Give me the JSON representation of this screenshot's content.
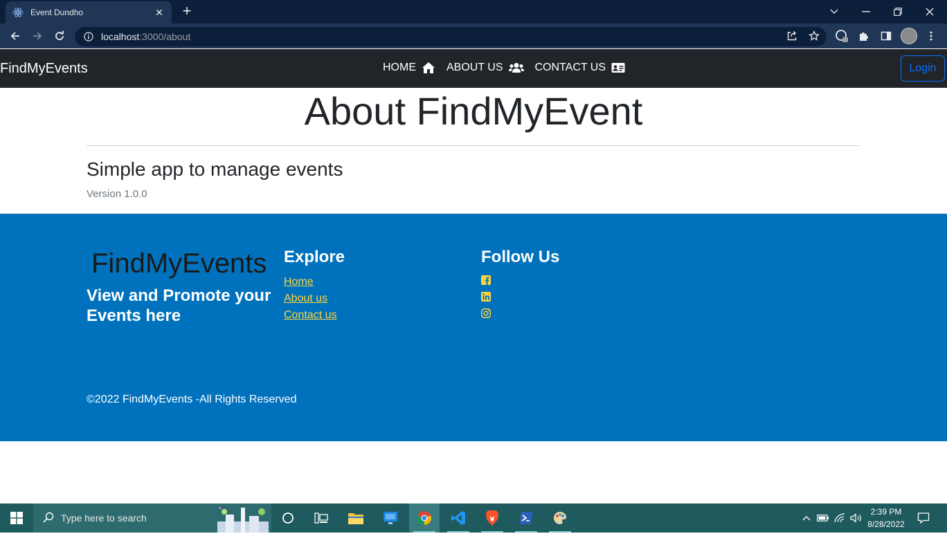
{
  "browser": {
    "tab_title": "Event Dundho",
    "url_host": "localhost",
    "url_path": ":3000/about"
  },
  "navbar": {
    "brand": "FindMyEvents",
    "links": [
      {
        "label": "HOME",
        "icon": "home-icon"
      },
      {
        "label": "ABOUT US",
        "icon": "users-icon"
      },
      {
        "label": "CONTACT US",
        "icon": "address-card-icon"
      }
    ],
    "login_label": "Login"
  },
  "about": {
    "title": "About FindMyEvent",
    "subtitle": "Simple app to manage events",
    "version": "Version 1.0.0"
  },
  "footer": {
    "brand": "FindMyEvents",
    "tagline": "View and Promote your Events here",
    "explore_heading": "Explore",
    "explore_links": [
      "Home",
      "About us",
      "Contact us"
    ],
    "follow_heading": "Follow Us",
    "social_icons": [
      "facebook-icon",
      "linkedin-icon",
      "instagram-icon"
    ],
    "copyright": "©2022 FindMyEvents -All Rights Reserved"
  },
  "taskbar": {
    "search_placeholder": "Type here to search",
    "time": "2:39 PM",
    "date": "8/28/2022"
  },
  "colors": {
    "navbar_bg": "#212529",
    "footer_bg": "#0072bd",
    "link_yellow": "#ffd43b",
    "login_blue": "#0d6efd",
    "taskbar_bg": "#1f5a5e"
  }
}
